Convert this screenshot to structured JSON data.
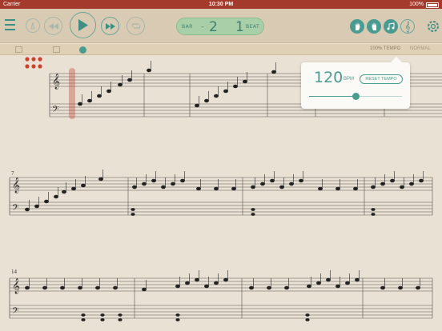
{
  "status_bar": {
    "carrier": "Carrier",
    "time": "10:30 PM",
    "battery": "100%"
  },
  "toolbar": {
    "menu_icon": "hamburger-icon",
    "icons": [
      "metronome-icon",
      "rewind-icon",
      "play-icon",
      "fast-forward-icon",
      "loop-icon",
      "left-hand-icon",
      "right-hand-icon",
      "notes-icon",
      "treble-clef-icon",
      "settings-icon"
    ]
  },
  "counter": {
    "bar_label": "BAR",
    "bar_prefix": "–",
    "bar_value": "2",
    "beat_value": "1",
    "beat_label": "BEAT"
  },
  "subbar": {
    "tempo_label": "100% TEMPO",
    "normal_label": "NORMAL"
  },
  "tempo_popover": {
    "bpm": "120",
    "unit": "BPM",
    "reset_label": "RESET TEMPO",
    "slider_fraction": 0.5
  },
  "score": {
    "measure_numbers": [
      "7",
      "14"
    ]
  },
  "colors": {
    "accent": "#4a9b90",
    "statusbar": "#a43a2c",
    "paper": "#e9e1d3"
  }
}
